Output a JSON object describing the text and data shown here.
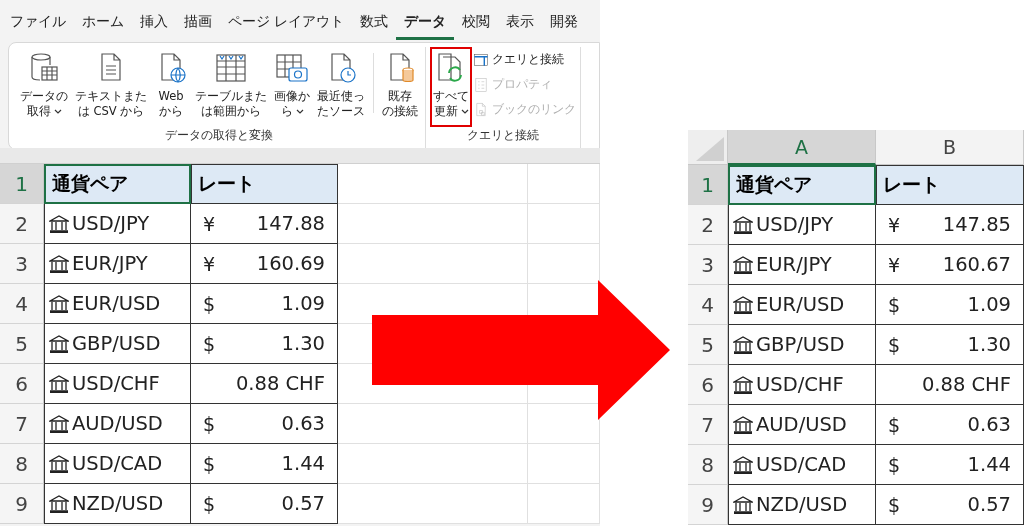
{
  "ribbon": {
    "tabs": [
      {
        "label": "ファイル",
        "selected": false
      },
      {
        "label": "ホーム",
        "selected": false
      },
      {
        "label": "挿入",
        "selected": false
      },
      {
        "label": "描画",
        "selected": false
      },
      {
        "label": "ページ レイアウト",
        "selected": false
      },
      {
        "label": "数式",
        "selected": false
      },
      {
        "label": "データ",
        "selected": true
      },
      {
        "label": "校閲",
        "selected": false
      },
      {
        "label": "表示",
        "selected": false
      },
      {
        "label": "開発",
        "selected": false
      }
    ],
    "groups": [
      {
        "label": "データの取得と変換",
        "buttons": [
          {
            "kind": "large",
            "lines": [
              "データの",
              "取得"
            ],
            "dropdown": true,
            "highlighted": false
          },
          {
            "kind": "large",
            "lines": [
              "テキストまた",
              "は CSV から"
            ],
            "dropdown": false,
            "highlighted": false
          },
          {
            "kind": "large",
            "lines": [
              "Web",
              "から"
            ],
            "dropdown": false,
            "highlighted": false
          },
          {
            "kind": "large",
            "lines": [
              "テーブルまた",
              "は範囲から"
            ],
            "dropdown": false,
            "highlighted": false
          },
          {
            "kind": "large",
            "lines": [
              "画像か",
              "ら"
            ],
            "dropdown": true,
            "highlighted": false
          },
          {
            "kind": "large",
            "lines": [
              "最近使っ",
              "たソース"
            ],
            "dropdown": false,
            "highlighted": false
          },
          {
            "kind": "separator"
          },
          {
            "kind": "large",
            "lines": [
              "既存",
              "の接続"
            ],
            "dropdown": false,
            "highlighted": false
          }
        ]
      },
      {
        "label": "クエリと接続",
        "buttons": [
          {
            "kind": "large",
            "lines": [
              "すべて",
              "更新"
            ],
            "dropdown": true,
            "highlighted": true
          },
          {
            "kind": "small",
            "label": "クエリと接続",
            "disabled": false
          },
          {
            "kind": "small",
            "label": "プロパティ",
            "disabled": true
          },
          {
            "kind": "small",
            "label": "ブックのリンク",
            "disabled": true
          }
        ]
      }
    ]
  },
  "before": {
    "header_number": "1",
    "header": [
      {
        "text": "通貨ペア",
        "selected": true
      },
      {
        "text": "レート",
        "selected": false
      }
    ],
    "rows": [
      {
        "number": "2",
        "pair": "USD/JPY",
        "symbol": "¥",
        "value": "147.88"
      },
      {
        "number": "3",
        "pair": "EUR/JPY",
        "symbol": "¥",
        "value": "160.69"
      },
      {
        "number": "4",
        "pair": "EUR/USD",
        "symbol": "$",
        "value": "1.09"
      },
      {
        "number": "5",
        "pair": "GBP/USD",
        "symbol": "$",
        "value": "1.30"
      },
      {
        "number": "6",
        "pair": "USD/CHF",
        "value": "0.88 CHF"
      },
      {
        "number": "7",
        "pair": "AUD/USD",
        "symbol": "$",
        "value": "0.63"
      },
      {
        "number": "8",
        "pair": "USD/CAD",
        "symbol": "$",
        "value": "1.44"
      },
      {
        "number": "9",
        "pair": "NZD/USD",
        "symbol": "$",
        "value": "0.57"
      }
    ]
  },
  "after": {
    "columns": [
      "A",
      "B"
    ],
    "header_number": "1",
    "header": [
      {
        "text": "通貨ペア",
        "selected": true
      },
      {
        "text": "レート",
        "selected": false
      }
    ],
    "rows": [
      {
        "number": "2",
        "pair": "USD/JPY",
        "symbol": "¥",
        "value": "147.85"
      },
      {
        "number": "3",
        "pair": "EUR/JPY",
        "symbol": "¥",
        "value": "160.67"
      },
      {
        "number": "4",
        "pair": "EUR/USD",
        "symbol": "$",
        "value": "1.09"
      },
      {
        "number": "5",
        "pair": "GBP/USD",
        "symbol": "$",
        "value": "1.30"
      },
      {
        "number": "6",
        "pair": "USD/CHF",
        "value": "0.88 CHF"
      },
      {
        "number": "7",
        "pair": "AUD/USD",
        "symbol": "$",
        "value": "0.63"
      },
      {
        "number": "8",
        "pair": "USD/CAD",
        "symbol": "$",
        "value": "1.44"
      },
      {
        "number": "9",
        "pair": "NZD/USD",
        "symbol": "$",
        "value": "0.57"
      }
    ]
  }
}
